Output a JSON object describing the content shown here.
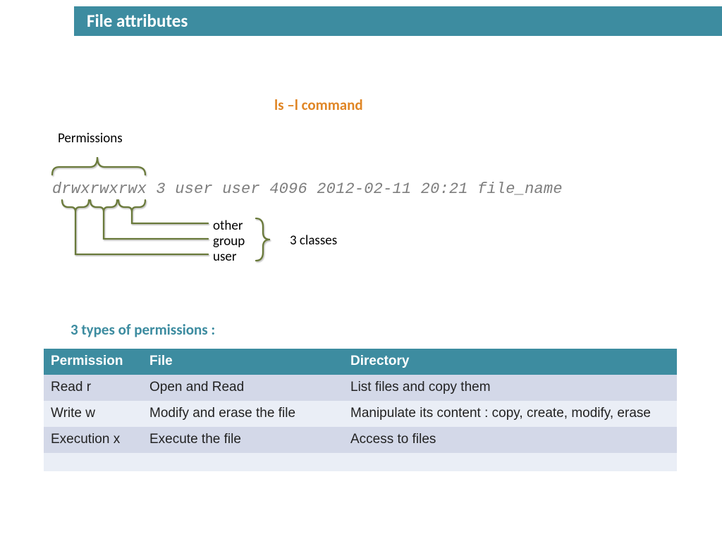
{
  "header": {
    "title": "File attributes"
  },
  "section": {
    "command_heading": "ls –l command",
    "perm_label": "Permissions",
    "ls_output": "drwxrwxrwx 3 user user 4096 2012-02-11 20:21 file_name",
    "classes": {
      "other": "other",
      "group": "group",
      "user": "user",
      "summary": "3 classes"
    },
    "types_heading": "3 types of permissions :"
  },
  "table": {
    "headers": {
      "permission": "Permission",
      "file": "File",
      "directory": "Directory"
    },
    "rows": [
      {
        "permission": "Read r",
        "file": "Open and Read",
        "directory": "List files and copy them"
      },
      {
        "permission": "Write w",
        "file": "Modify and erase the file",
        "directory": "Manipulate its content : copy, create, modify, erase"
      },
      {
        "permission": "Execution x",
        "file": "Execute the file",
        "directory": "Access to files"
      }
    ]
  }
}
